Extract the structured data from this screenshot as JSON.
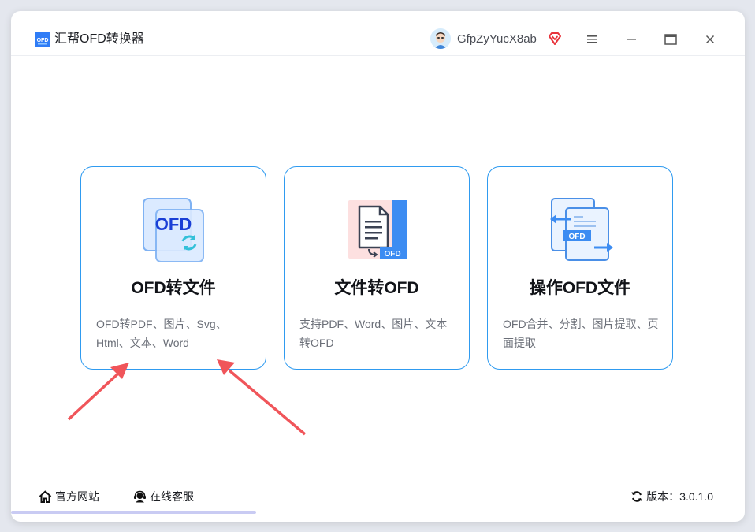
{
  "app": {
    "title": "汇帮OFD转换器",
    "logo_text": "OFD"
  },
  "user": {
    "name": "GfpZyYucX8ab"
  },
  "window_controls": {
    "menu": "menu-icon",
    "minimize": "minimize-icon",
    "maximize": "maximize-icon",
    "close": "close-icon"
  },
  "cards": [
    {
      "title": "OFD转文件",
      "desc": "OFD转PDF、图片、Svg、Html、文本、Word",
      "icon_text": "OFD"
    },
    {
      "title": "文件转OFD",
      "desc": "支持PDF、Word、图片、文本转OFD",
      "icon_text": "OFD"
    },
    {
      "title": "操作OFD文件",
      "desc": "OFD合并、分割、图片提取、页面提取",
      "icon_text": "OFD"
    }
  ],
  "footer": {
    "website": "官方网站",
    "support": "在线客服",
    "version": "版本：3.0.1.0"
  },
  "colors": {
    "accent": "#2f9bf0",
    "arrow": "#f0555a",
    "vip": "#e8333b"
  }
}
